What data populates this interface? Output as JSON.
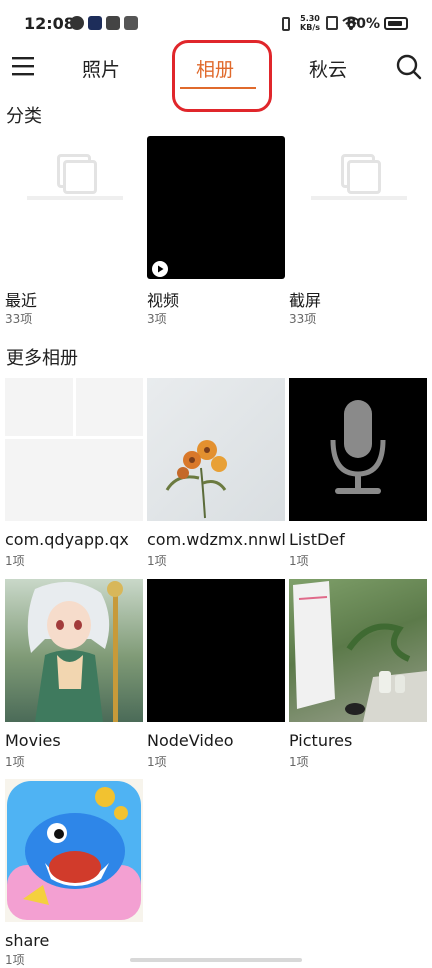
{
  "status_bar": {
    "time": "12:08",
    "network_speed_value": "5.30",
    "network_speed_unit": "KB/s",
    "battery": "80%"
  },
  "nav": {
    "menu_icon": "menu-icon",
    "tabs": [
      {
        "label": "照片"
      },
      {
        "label": "相册"
      },
      {
        "label": "秋云"
      }
    ],
    "active_tab": "相册",
    "search_icon": "search-icon"
  },
  "sections": {
    "categories_title": "分类",
    "more_albums_title": "更多相册"
  },
  "categories": [
    {
      "name": "最近",
      "count": "33项",
      "thumb": "placeholder"
    },
    {
      "name": "视频",
      "count": "3项",
      "thumb": "video-black"
    },
    {
      "name": "截屏",
      "count": "33项",
      "thumb": "placeholder"
    }
  ],
  "albums": [
    {
      "name": "com.qdyapp.qx",
      "count": "1项",
      "thumb": "grid-placeholder"
    },
    {
      "name": "com.wdzmx.nnwl",
      "count": "1项",
      "thumb": "flower-photo"
    },
    {
      "name": "ListDef",
      "count": "1项",
      "thumb": "microphone"
    },
    {
      "name": "Movies",
      "count": "1项",
      "thumb": "anime-girl"
    },
    {
      "name": "NodeVideo",
      "count": "1项",
      "thumb": "black"
    },
    {
      "name": "Pictures",
      "count": "1项",
      "thumb": "desk-photo"
    },
    {
      "name": "share",
      "count": "1项",
      "thumb": "game-icon"
    }
  ],
  "colors": {
    "accent": "#e06a2c",
    "highlight": "#e0262b"
  }
}
